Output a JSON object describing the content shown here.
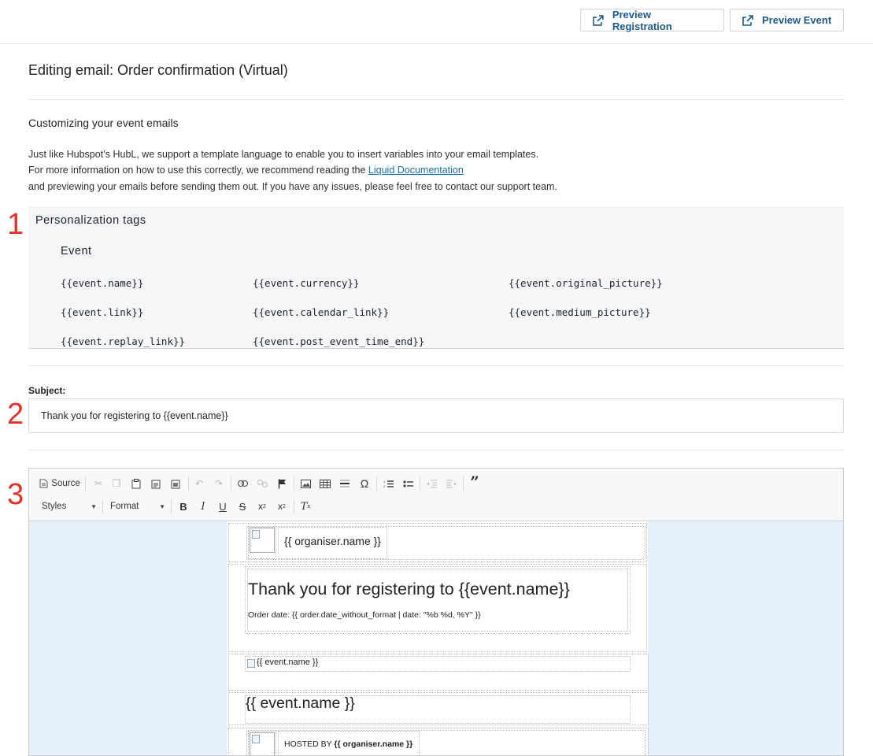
{
  "header": {
    "preview_registration_label": "Preview Registration",
    "preview_event_label": "Preview Event"
  },
  "page": {
    "title": "Editing email: Order confirmation (Virtual)"
  },
  "intro": {
    "heading": "Customizing your event emails",
    "line1": "Just like Hubspot’s HubL, we support a template language to enable you to insert variables into your email templates.",
    "line2_prefix": "For more information on how to use this correctly, we recommend reading the ",
    "line2_link": "Liquid Documentation",
    "line3": "and previewing your emails before sending them out. If you have any issues, please feel free to contact our support team."
  },
  "markers": [
    "1",
    "2",
    "3"
  ],
  "personalization": {
    "title": "Personalization tags",
    "group": "Event",
    "tags": [
      "{{event.name}}",
      "{{event.currency}}",
      "{{event.original_picture}}",
      "{{event.link}}",
      "{{event.calendar_link}}",
      "{{event.medium_picture}}",
      "{{event.replay_link}}",
      "{{event.post_event_time_end}}"
    ]
  },
  "subject": {
    "label": "Subject:",
    "value": "Thank you for registering to {{event.name}}"
  },
  "editor": {
    "source_label": "Source",
    "styles_label": "Styles",
    "format_label": "Format",
    "toolbar_icons": [
      "source-icon",
      "cut-icon",
      "copy-icon",
      "paste-icon",
      "paste-text-icon",
      "paste-word-icon",
      "undo-icon",
      "redo-icon",
      "link-icon",
      "unlink-icon",
      "anchor-flag-icon",
      "image-icon",
      "table-icon",
      "horizontal-line-icon",
      "special-char-icon",
      "numbered-list-icon",
      "bulleted-list-icon",
      "outdent-icon",
      "indent-icon",
      "blockquote-icon",
      "bold-icon",
      "italic-icon",
      "underline-icon",
      "strikethrough-icon",
      "subscript-icon",
      "superscript-icon",
      "remove-format-icon"
    ],
    "content": {
      "organiser_name": "{{ organiser.name }}",
      "heading": "Thank you for registering to {{event.name}}",
      "order_date": "Order date: {{ order.date_without_format | date: \"%b %d, %Y\" }}",
      "event_image_alt": "{{ event.name }}",
      "event_name": "{{ event.name }}",
      "hosted_by_prefix": "HOSTED BY ",
      "hosted_by_name": "{{ organiser.name }}"
    }
  },
  "colors": {
    "accent": "#1c5a86",
    "marker": "#e0332a",
    "canvas_bg": "#e7f0fd",
    "tags_bg": "#f5f6f7"
  }
}
